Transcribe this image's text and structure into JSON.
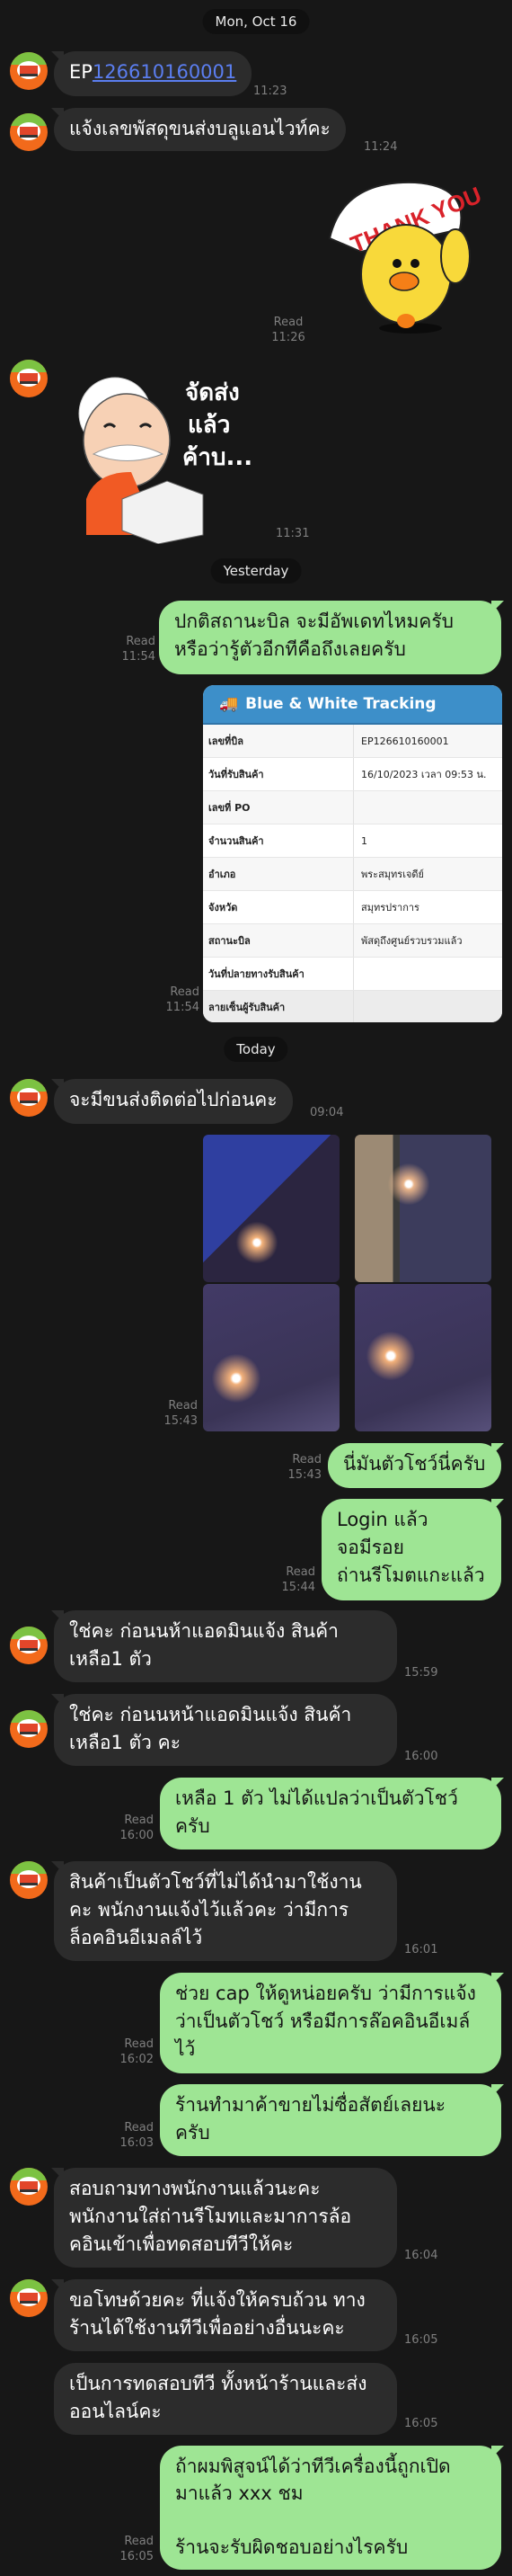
{
  "dates": {
    "d1": "Mon, Oct 16",
    "d2": "Yesterday",
    "d3": "Today"
  },
  "colors": {
    "background": "#171717",
    "incoming": "#2c2c2c",
    "outgoing": "#9ee594",
    "link": "#5b7ef0",
    "tracking_header": "#3d8fc9"
  },
  "messages": {
    "m1": {
      "prefix": "EP",
      "link": "126610160001",
      "time": "11:23"
    },
    "m2": {
      "text": "แจ้งเลขพัสดุขนส่งบลูแอนไวท์คะ",
      "time": "11:24"
    },
    "sticker_thanks": {
      "text": "THANK YOU",
      "read": "Read",
      "time": "11:26"
    },
    "sticker_shipped": {
      "text": "จัดส่ง\nแล้ว\nค้าบ...",
      "time": "11:31"
    },
    "s1": {
      "text": "ปกติสถานะบิล จะมีอัพเดทไหมครับ\nหรือว่ารู้ตัวอีกทีคือถึงเลยครับ",
      "read": "Read",
      "time": "11:54"
    },
    "tracking": {
      "title": "Blue & White Tracking",
      "read": "Read",
      "time": "11:54",
      "rows": [
        {
          "k": "เลขที่บิล",
          "v": "EP126610160001"
        },
        {
          "k": "วันที่รับสินค้า",
          "v": "16/10/2023 เวลา 09:53 น."
        },
        {
          "k": "เลขที่ PO",
          "v": ""
        },
        {
          "k": "จำนวนสินค้า",
          "v": "1"
        },
        {
          "k": "อำเภอ",
          "v": "พระสมุทรเจดีย์"
        },
        {
          "k": "จังหวัด",
          "v": "สมุทรปราการ"
        },
        {
          "k": "สถานะบิล",
          "v": "พัสดุถึงศูนย์รวบรวมแล้ว"
        },
        {
          "k": "วันที่ปลายทางรับสินค้า",
          "v": ""
        },
        {
          "k": "ลายเซ็นผู้รับสินค้า",
          "v": ""
        }
      ]
    },
    "m3": {
      "text": "จะมีขนส่งติดต่อไปก่อนคะ",
      "time": "09:04"
    },
    "photos": {
      "read": "Read",
      "time": "15:43"
    },
    "s2": {
      "text": "นี่มันตัวโชว์นี่ครับ",
      "read": "Read",
      "time": "15:43"
    },
    "s3": {
      "text": "Login แล้ว\nจอมีรอย\nถ่านรีโมตแกะแล้ว",
      "read": "Read",
      "time": "15:44"
    },
    "m4": {
      "text": "ใช่คะ ก่อนนห้าแอดมินแจ้ง สินค้า\nเหลือ1 ตัว",
      "time": "15:59"
    },
    "m5": {
      "text": "ใช่คะ ก่อนนหน้าแอดมินแจ้ง สินค้า\nเหลือ1 ตัว คะ",
      "time": "16:00"
    },
    "s4": {
      "text": "เหลือ 1 ตัว ไม่ได้แปลว่าเป็นตัวโชว์\nครับ",
      "read": "Read",
      "time": "16:00"
    },
    "m6": {
      "text": "สินค้าเป็นตัวโชว์ที่ไม่ได้นำมาใช้งาน\nคะ พนักงานแจ้งไว้แล้วคะ ว่ามีการ\nล็อคอินอีเมลล์ไว้",
      "time": "16:01"
    },
    "s5": {
      "text": "ช่วย cap ให้ดูหน่อยครับ ว่ามีการแจ้ง\nว่าเป็นตัวโชว์ หรือมีการล๊อคอินอีเมล์\nไว้",
      "read": "Read",
      "time": "16:02"
    },
    "s6": {
      "text": "ร้านทำมาค้าขายไม่ซื่อสัตย์เลยนะ\nครับ",
      "read": "Read",
      "time": "16:03"
    },
    "m7": {
      "text": "สอบถามทางพนักงานแล้วนะคะ\nพนักงานใส่ถ่านรีโมทและมาการล้อ\nคอินเข้าเพื่อทดสอบทีวีให้คะ",
      "time": "16:04"
    },
    "m8": {
      "text": "ขอโทษด้วยคะ ที่แจ้งให้ครบถ้วน ทาง\nร้านได้ใช้งานทีวีเพื่ออย่างอื่นนะคะ",
      "time": "16:05"
    },
    "m9": {
      "text": "เป็นการทดสอบทีวี ทั้งหน้าร้านและส่ง\nออนไลน์คะ",
      "time": "16:05"
    },
    "s7": {
      "text": "ถ้าผมพิสูจน์ได้ว่าทีวีเครื่องนี้ถูกเปิด\nมาแล้ว xxx ชม\n\nร้านจะรับผิดชอบอย่างไรครับ",
      "read": "Read",
      "time": "16:05"
    }
  }
}
